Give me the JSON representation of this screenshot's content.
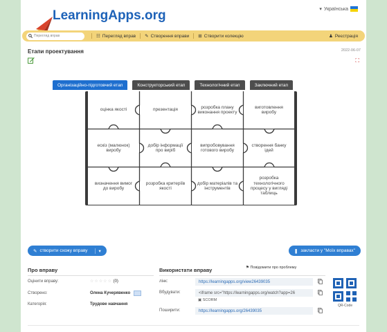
{
  "header": {
    "logo_text": "LearningApps.org",
    "language": "Українська"
  },
  "nav": {
    "search_placeholder": "Перегляд вправ",
    "items": [
      "Перегляд вправ",
      "Створення вправи",
      "Створити колекцію"
    ],
    "register": "Реєстрація"
  },
  "page": {
    "title": "Етапи проектування",
    "date": "2022-06-07"
  },
  "tabs": [
    "Організаційно-підготовчий етап",
    "Конструкторський етап",
    "Технологічний етап",
    "Заключний етап"
  ],
  "puzzle": [
    [
      "оцінка якості",
      "презентація",
      "розробка плану виконання проекту",
      "виготовлення виробу"
    ],
    [
      "ескіз (малюнок) виробу",
      "добір інформації про виріб",
      "випробовування готового виробу",
      "створення банку ідей"
    ],
    [
      "визначення вимог до виробу",
      "розробка критеріїв якості",
      "добір матеріалів та інструментів",
      "розробка технологічного процесу у вигляді таблиць"
    ]
  ],
  "actions": {
    "create_similar": "створити схожу вправу",
    "bookmark": "закласти у \"Моїх вправах\""
  },
  "about": {
    "heading": "Про вправу",
    "rate_label": "Оцінити вправу:",
    "rate_count": "(0)",
    "created_label": "Створено:",
    "author": "Олена Кучерявенко",
    "category_label": "Категорія:",
    "category": "Трудове навчання"
  },
  "use": {
    "heading": "Використати вправу",
    "report": "Повідомити про проблему",
    "link_label": "лінк:",
    "link": "https://learningapps.org/view26439035",
    "embed_label": "Вбудувати:",
    "embed": "<iframe src=\"https://learningapps.org/watch?app=26",
    "scorm": "SCORM",
    "share_label": "Поширити:",
    "share": "https://learningapps.org/26439035",
    "qr_label": "QR-Code"
  }
}
